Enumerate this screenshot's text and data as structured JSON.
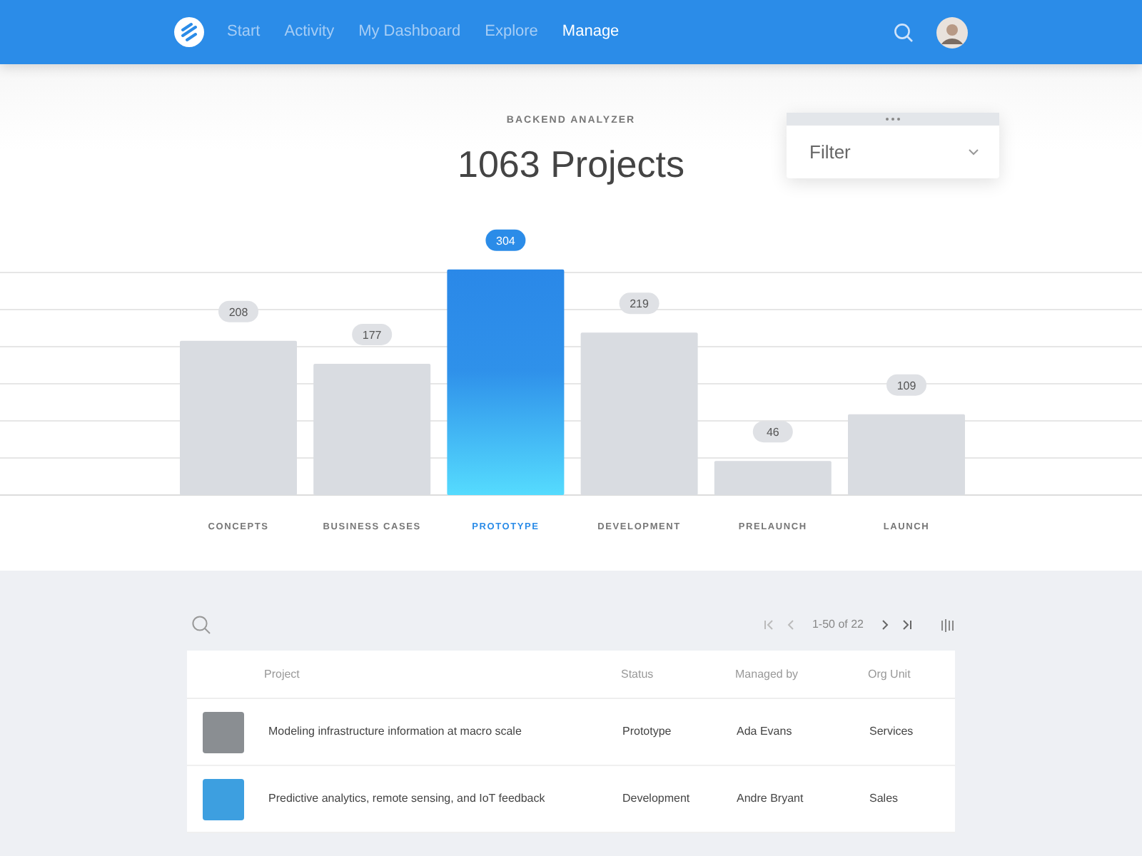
{
  "navbar": {
    "items": [
      {
        "label": "Start",
        "selected": false
      },
      {
        "label": "Activity",
        "selected": false
      },
      {
        "label": "My Dashboard",
        "selected": false
      },
      {
        "label": "Explore",
        "selected": false
      },
      {
        "label": "Manage",
        "selected": true
      }
    ]
  },
  "header": {
    "eyebrow": "BACKEND ANALYZER",
    "title": "1063 Projects"
  },
  "filter": {
    "placeholder": "Filter"
  },
  "pipeline": {
    "chart_data": {
      "type": "bar",
      "categories": [
        "CONCEPTS",
        "BUSINESS CASES",
        "PROTOTYPE",
        "DEVELOPMENT",
        "PRELAUNCH",
        "LAUNCH"
      ],
      "values": [
        208,
        177,
        304,
        219,
        46,
        109
      ],
      "data_labels": true
    },
    "stages": [
      {
        "selected": false
      },
      {
        "selected": false
      },
      {
        "selected": true
      },
      {
        "selected": false
      },
      {
        "selected": false
      },
      {
        "selected": false
      }
    ]
  },
  "pagination": {
    "range": "1-50 of 22"
  },
  "table": {
    "columns": [
      "Project",
      "Status",
      "Managed by",
      "Org Unit"
    ],
    "rows": [
      {
        "project": "Modeling infrastructure information at macro scale",
        "status": "Prototype",
        "managed_by": "Ada Evans",
        "org_unit": "Services"
      },
      {
        "project": "Predictive analytics, remote sensing, and IoT feedback",
        "status": "Development",
        "managed_by": "Andre Bryant",
        "org_unit": "Sales"
      }
    ]
  }
}
